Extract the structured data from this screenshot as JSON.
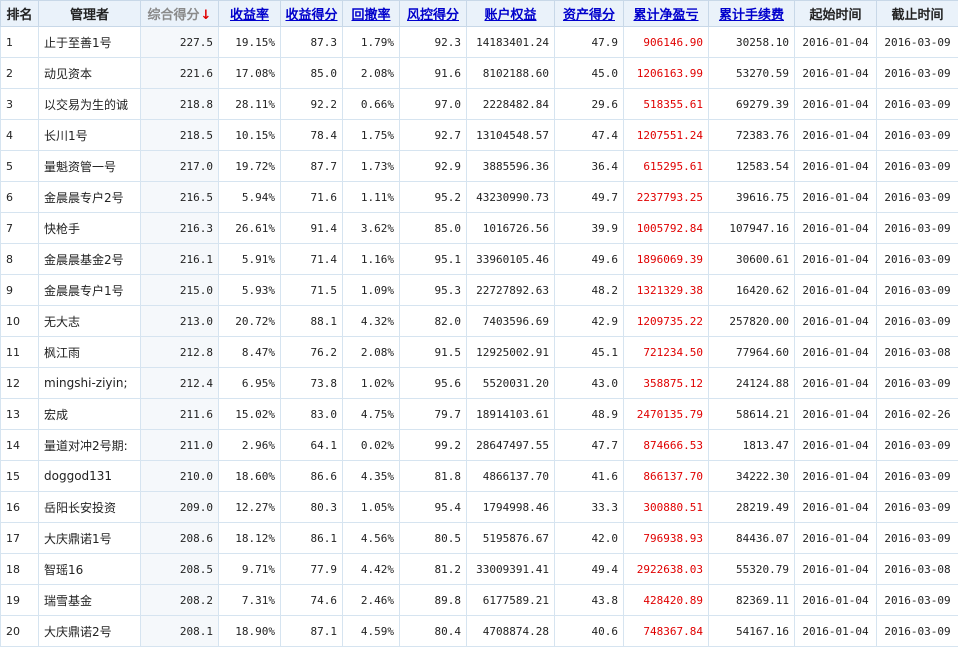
{
  "headers": {
    "rank": "排名",
    "manager": "管理者",
    "total_score": "综合得分",
    "total_score_sort_arrow": "↓",
    "return_rate": "收益率",
    "return_score": "收益得分",
    "drawdown": "回撤率",
    "risk_score": "风控得分",
    "equity": "账户权益",
    "asset_score": "资产得分",
    "cum_pnl": "累计净盈亏",
    "cum_fee": "累计手续费",
    "start": "起始时间",
    "end": "截止时间"
  },
  "rows": [
    [
      "1",
      "止于至善1号",
      "227.5",
      "19.15%",
      "87.3",
      "1.79%",
      "92.3",
      "14183401.24",
      "47.9",
      "906146.90",
      "30258.10",
      "2016-01-04",
      "2016-03-09"
    ],
    [
      "2",
      "动见资本",
      "221.6",
      "17.08%",
      "85.0",
      "2.08%",
      "91.6",
      "8102188.60",
      "45.0",
      "1206163.99",
      "53270.59",
      "2016-01-04",
      "2016-03-09"
    ],
    [
      "3",
      "以交易为生的诚",
      "218.8",
      "28.11%",
      "92.2",
      "0.66%",
      "97.0",
      "2228482.84",
      "29.6",
      "518355.61",
      "69279.39",
      "2016-01-04",
      "2016-03-09"
    ],
    [
      "4",
      "长川1号",
      "218.5",
      "10.15%",
      "78.4",
      "1.75%",
      "92.7",
      "13104548.57",
      "47.4",
      "1207551.24",
      "72383.76",
      "2016-01-04",
      "2016-03-09"
    ],
    [
      "5",
      "量魁资管一号",
      "217.0",
      "19.72%",
      "87.7",
      "1.73%",
      "92.9",
      "3885596.36",
      "36.4",
      "615295.61",
      "12583.54",
      "2016-01-04",
      "2016-03-09"
    ],
    [
      "6",
      "金晨晨专户2号",
      "216.5",
      "5.94%",
      "71.6",
      "1.11%",
      "95.2",
      "43230990.73",
      "49.7",
      "2237793.25",
      "39616.75",
      "2016-01-04",
      "2016-03-09"
    ],
    [
      "7",
      "快枪手",
      "216.3",
      "26.61%",
      "91.4",
      "3.62%",
      "85.0",
      "1016726.56",
      "39.9",
      "1005792.84",
      "107947.16",
      "2016-01-04",
      "2016-03-09"
    ],
    [
      "8",
      "金晨晨基金2号",
      "216.1",
      "5.91%",
      "71.4",
      "1.16%",
      "95.1",
      "33960105.46",
      "49.6",
      "1896069.39",
      "30600.61",
      "2016-01-04",
      "2016-03-09"
    ],
    [
      "9",
      "金晨晨专户1号",
      "215.0",
      "5.93%",
      "71.5",
      "1.09%",
      "95.3",
      "22727892.63",
      "48.2",
      "1321329.38",
      "16420.62",
      "2016-01-04",
      "2016-03-09"
    ],
    [
      "10",
      "无大志",
      "213.0",
      "20.72%",
      "88.1",
      "4.32%",
      "82.0",
      "7403596.69",
      "42.9",
      "1209735.22",
      "257820.00",
      "2016-01-04",
      "2016-03-09"
    ],
    [
      "11",
      "枫江雨",
      "212.8",
      "8.47%",
      "76.2",
      "2.08%",
      "91.5",
      "12925002.91",
      "45.1",
      "721234.50",
      "77964.60",
      "2016-01-04",
      "2016-03-08"
    ],
    [
      "12",
      "mingshi-ziyin;",
      "212.4",
      "6.95%",
      "73.8",
      "1.02%",
      "95.6",
      "5520031.20",
      "43.0",
      "358875.12",
      "24124.88",
      "2016-01-04",
      "2016-03-09"
    ],
    [
      "13",
      "宏成",
      "211.6",
      "15.02%",
      "83.0",
      "4.75%",
      "79.7",
      "18914103.61",
      "48.9",
      "2470135.79",
      "58614.21",
      "2016-01-04",
      "2016-02-26"
    ],
    [
      "14",
      "量道对冲2号期:",
      "211.0",
      "2.96%",
      "64.1",
      "0.02%",
      "99.2",
      "28647497.55",
      "47.7",
      "874666.53",
      "1813.47",
      "2016-01-04",
      "2016-03-09"
    ],
    [
      "15",
      "doggod131",
      "210.0",
      "18.60%",
      "86.6",
      "4.35%",
      "81.8",
      "4866137.70",
      "41.6",
      "866137.70",
      "34222.30",
      "2016-01-04",
      "2016-03-09"
    ],
    [
      "16",
      "岳阳长安投资",
      "209.0",
      "12.27%",
      "80.3",
      "1.05%",
      "95.4",
      "1794998.46",
      "33.3",
      "300880.51",
      "28219.49",
      "2016-01-04",
      "2016-03-09"
    ],
    [
      "17",
      "大庆鼎诺1号",
      "208.6",
      "18.12%",
      "86.1",
      "4.56%",
      "80.5",
      "5195876.67",
      "42.0",
      "796938.93",
      "84436.07",
      "2016-01-04",
      "2016-03-09"
    ],
    [
      "18",
      "智瑶16",
      "208.5",
      "9.71%",
      "77.9",
      "4.42%",
      "81.2",
      "33009391.41",
      "49.4",
      "2922638.03",
      "55320.79",
      "2016-01-04",
      "2016-03-08"
    ],
    [
      "19",
      "瑞雪基金",
      "208.2",
      "7.31%",
      "74.6",
      "2.46%",
      "89.8",
      "6177589.21",
      "43.8",
      "428420.89",
      "82369.11",
      "2016-01-04",
      "2016-03-09"
    ],
    [
      "20",
      "大庆鼎诺2号",
      "208.1",
      "18.90%",
      "87.1",
      "4.59%",
      "80.4",
      "4708874.28",
      "40.6",
      "748367.84",
      "54167.16",
      "2016-01-04",
      "2016-03-09"
    ]
  ],
  "colors": {
    "link": "#0000cc",
    "profit_red": "#e00000",
    "header_bg": "#eaf2fa",
    "border": "#c8d8e8"
  }
}
